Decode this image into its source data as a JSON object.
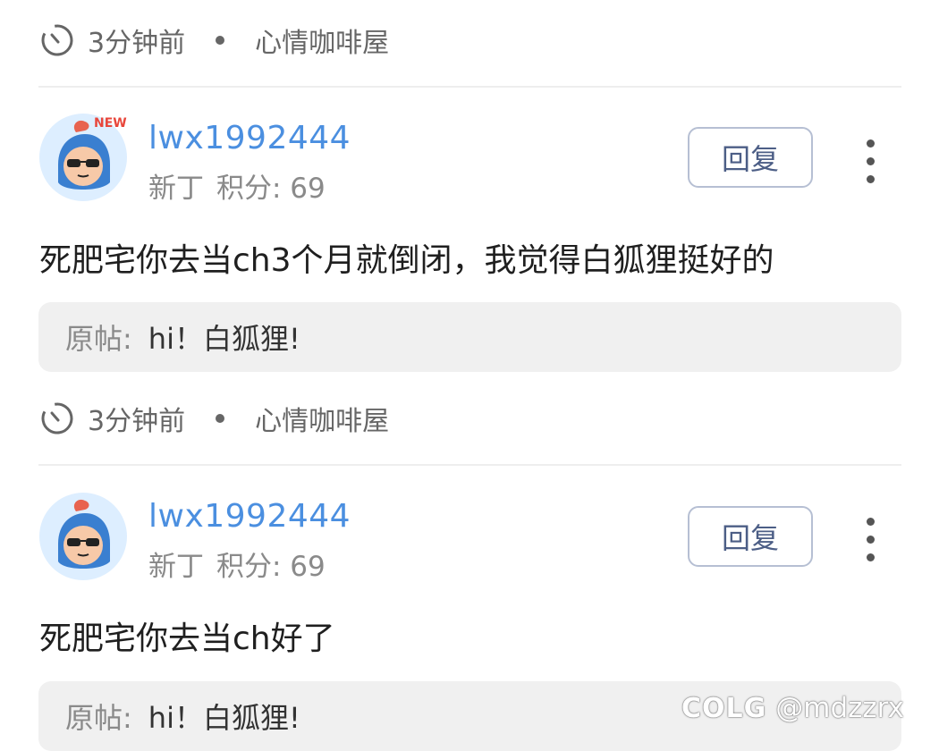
{
  "posts_top_meta": {
    "time": "3分钟前",
    "forum": "心情咖啡屋"
  },
  "posts": [
    {
      "username": "lwx1992444",
      "badge": "NEW",
      "rank": "新丁",
      "points": "积分: 69",
      "reply_label": "回复",
      "content": "死肥宅你去当ch3个月就倒闭，我觉得白狐狸挺好的",
      "quote_label": "原帖:",
      "quote_text": "hi！白狐狸!",
      "time": "3分钟前",
      "forum": "心情咖啡屋"
    },
    {
      "username": "lwx1992444",
      "rank": "新丁",
      "points": "积分: 69",
      "reply_label": "回复",
      "content": "死肥宅你去当ch好了",
      "quote_label": "原帖:",
      "quote_text": "hi！白狐狸!"
    }
  ],
  "watermark": {
    "logo": "COLG",
    "handle": "@mdzzrx"
  },
  "colors": {
    "username": "#4b8fe0",
    "reply_border": "#b6bfd3",
    "quote_bg": "#f0f0f0",
    "badge": "#e8463b"
  }
}
